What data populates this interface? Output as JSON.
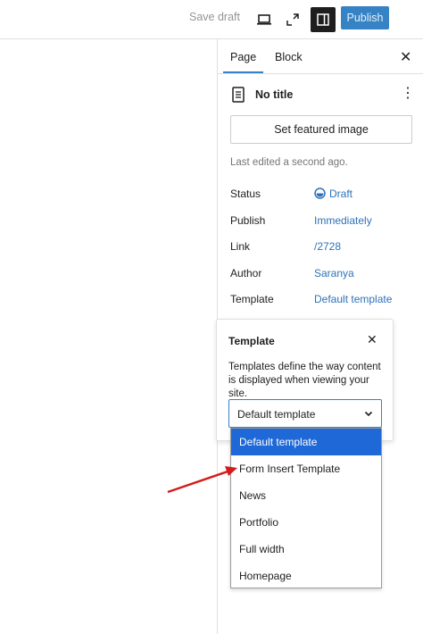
{
  "toolbar": {
    "save_draft": "Save draft",
    "publish": "Publish",
    "icons": [
      "laptop-icon",
      "fullscreen-icon",
      "sidebar-toggle-icon"
    ]
  },
  "sidebar": {
    "tabs": {
      "page": "Page",
      "block": "Block"
    },
    "doc_title": "No title",
    "featured_image": "Set featured image",
    "last_edited": "Last edited a second ago.",
    "properties": [
      {
        "label": "Status",
        "value": "Draft"
      },
      {
        "label": "Publish",
        "value": "Immediately"
      },
      {
        "label": "Link",
        "value": "/2728"
      },
      {
        "label": "Author",
        "value": "Saranya"
      },
      {
        "label": "Template",
        "value": "Default template"
      }
    ]
  },
  "template_popover": {
    "title": "Template",
    "description": "Templates define the way content is displayed when viewing your site.",
    "selected": "Default template",
    "options": [
      "Default template",
      "Form Insert Template",
      "News",
      "Portfolio",
      "Full width",
      "Homepage"
    ]
  },
  "colors": {
    "accent": "#3582c4",
    "selected_option": "#1e68d8",
    "annotation_arrow": "#d41c1c"
  }
}
